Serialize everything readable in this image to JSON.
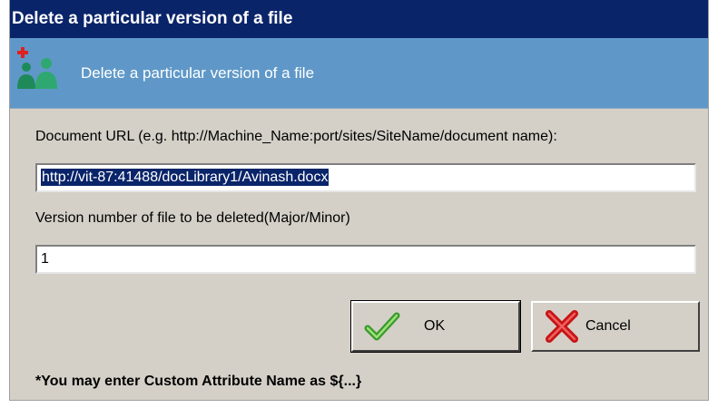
{
  "window": {
    "title": "Delete a particular version of a file"
  },
  "banner": {
    "text": "Delete a particular version of a file",
    "icon": "users-add-icon"
  },
  "form": {
    "url_label": "Document URL (e.g. http://Machine_Name:port/sites/SiteName/document name):",
    "url_value": "http://vit-87:41488/docLibrary1/Avinash.docx",
    "version_label": "Version number of file to be deleted(Major/Minor)",
    "version_value": "1"
  },
  "buttons": {
    "ok_label": "OK",
    "ok_icon": "checkmark-icon",
    "cancel_label": "Cancel",
    "cancel_icon": "red-x-icon"
  },
  "footnote": "*You may enter Custom Attribute Name as ${...}",
  "colors": {
    "titlebar": "#0a246a",
    "banner": "#5f98c8",
    "dialog_bg": "#d4d0c8",
    "selection": "#0a246a"
  }
}
